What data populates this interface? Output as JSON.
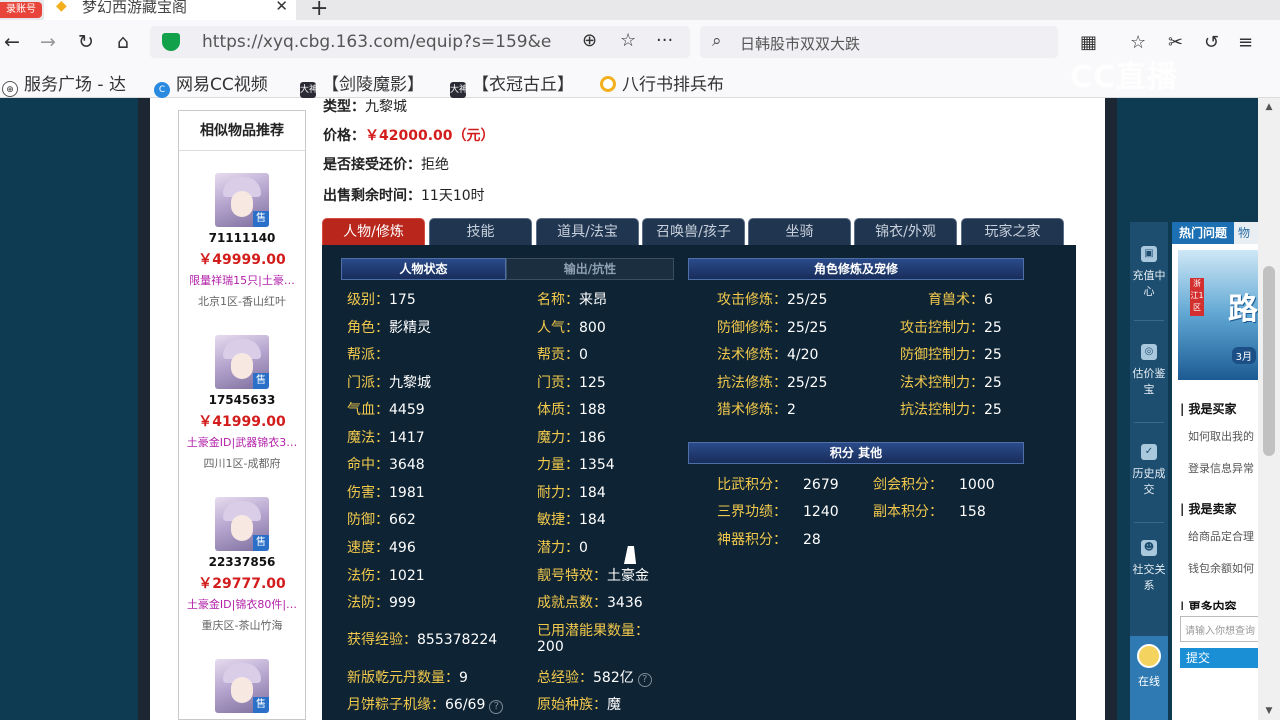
{
  "browser": {
    "record_badge": "录账号",
    "tab_title": "梦幻西游藏宝阁",
    "url": "https://xyq.cbg.163.com/equip?s=159&e",
    "search_text": "日韩股市双双大跌",
    "bookmarks": [
      "服务广场 - 达",
      "网易CC视频",
      "【剑陵魔影】",
      "【衣冠古丘】",
      "八行书排兵布"
    ],
    "bookmark_badge": "大神",
    "watermark": "CC直播"
  },
  "similar": {
    "title": "相似物品推荐",
    "sell_badge": "售",
    "items": [
      {
        "id": "71111140",
        "price": "￥49999.00",
        "tags": "限量祥瑞15只|土豪…",
        "server": "北京1区-香山红叶"
      },
      {
        "id": "17545633",
        "price": "￥41999.00",
        "tags": "土豪金ID|武器锦衣3…",
        "server": "四川1区-成都府"
      },
      {
        "id": "22337856",
        "price": "￥29777.00",
        "tags": "土豪金ID|锦衣80件|…",
        "server": "重庆区-茶山竹海"
      },
      {
        "id": "",
        "price": "",
        "tags": "",
        "server": ""
      }
    ]
  },
  "info": {
    "type_label": "类型：",
    "type_value": "九黎城",
    "price_label": "价格：",
    "price_value": "￥42000.00（元）",
    "bargain_label": "是否接受还价：",
    "bargain_value": "拒绝",
    "remaining_label": "出售剩余时间：",
    "remaining_value": "11天10时"
  },
  "tabs": [
    "人物/修炼",
    "技能",
    "道具/法宝",
    "召唤兽/孩子",
    "坐骑",
    "锦衣/外观",
    "玩家之家"
  ],
  "panel": {
    "subtab_active": "人物状态",
    "subtab_other": "输出/抗性",
    "cultivation_header": "角色修炼及宠修",
    "score_header": "积分 其他",
    "left_col": [
      {
        "label": "级别：",
        "value": "175"
      },
      {
        "label": "角色：",
        "value": "影精灵"
      },
      {
        "label": "帮派：",
        "value": ""
      },
      {
        "label": "门派：",
        "value": "九黎城"
      },
      {
        "label": "气血：",
        "value": "4459"
      },
      {
        "label": "魔法：",
        "value": "1417"
      },
      {
        "label": "命中：",
        "value": "3648"
      },
      {
        "label": "伤害：",
        "value": "1981"
      },
      {
        "label": "防御：",
        "value": "662"
      },
      {
        "label": "速度：",
        "value": "496"
      },
      {
        "label": "法伤：",
        "value": "1021"
      },
      {
        "label": "法防：",
        "value": "999"
      }
    ],
    "mid_col": [
      {
        "label": "名称：",
        "value": "来昂"
      },
      {
        "label": "人气：",
        "value": "800"
      },
      {
        "label": "帮贡：",
        "value": "0"
      },
      {
        "label": "门贡：",
        "value": "125"
      },
      {
        "label": "体质：",
        "value": "188"
      },
      {
        "label": "魔力：",
        "value": "186"
      },
      {
        "label": "力量：",
        "value": "1354"
      },
      {
        "label": "耐力：",
        "value": "184"
      },
      {
        "label": "敏捷：",
        "value": "184"
      },
      {
        "label": "潜力：",
        "value": "0"
      },
      {
        "label": "靓号特效：",
        "value": "土豪金"
      },
      {
        "label": "成就点数：",
        "value": "3436"
      }
    ],
    "exp": {
      "label": "获得经验：",
      "value": "855378224"
    },
    "used_fruit": {
      "label": "已用潜能果数量：",
      "value": "200"
    },
    "qianyuan": {
      "label": "新版乾元丹数量：",
      "value": "9"
    },
    "total_exp": {
      "label": "总经验：",
      "value": "582亿"
    },
    "zongzi": {
      "label": "月饼粽子机缘：",
      "value": "66/69"
    },
    "race": {
      "label": "原始种族：",
      "value": "魔"
    },
    "help_glyph": "?",
    "cultivation": [
      {
        "label": "攻击修炼：",
        "value": "25/25",
        "label2": "育兽术：",
        "value2": "6"
      },
      {
        "label": "防御修炼：",
        "value": "25/25",
        "label2": "攻击控制力：",
        "value2": "25"
      },
      {
        "label": "法术修炼：",
        "value": "4/20",
        "label2": "防御控制力：",
        "value2": "25"
      },
      {
        "label": "抗法修炼：",
        "value": "25/25",
        "label2": "法术控制力：",
        "value2": "25"
      },
      {
        "label": "猎术修炼：",
        "value": "2",
        "label2": "抗法控制力：",
        "value2": "25"
      }
    ],
    "scores": [
      {
        "label": "比武积分：",
        "value": "2679",
        "label2": "剑会积分：",
        "value2": "1000"
      },
      {
        "label": "三界功绩：",
        "value": "1240",
        "label2": "副本积分：",
        "value2": "158"
      },
      {
        "label": "神器积分：",
        "value": "28",
        "label2": "",
        "value2": ""
      }
    ]
  },
  "side_nav": [
    {
      "label": "充值中心"
    },
    {
      "label": "估价鉴宝"
    },
    {
      "label": "历史成交"
    },
    {
      "label": "社交关系"
    }
  ],
  "online_service": "在线",
  "hot": {
    "tab_active": "热门问题",
    "tab_other": "物",
    "banner_text": "路",
    "banner_tag": "浙江1区",
    "banner_month": "3月",
    "buyer_title": "| 我是买家",
    "buyer_links": [
      "如何取出我的",
      "登录信息异常"
    ],
    "seller_title": "| 我是卖家",
    "seller_links": [
      "给商品定合理",
      "钱包余额如何"
    ],
    "more_title": "| 更多内容",
    "input_placeholder": "请输入你想查询",
    "submit": "提交"
  }
}
